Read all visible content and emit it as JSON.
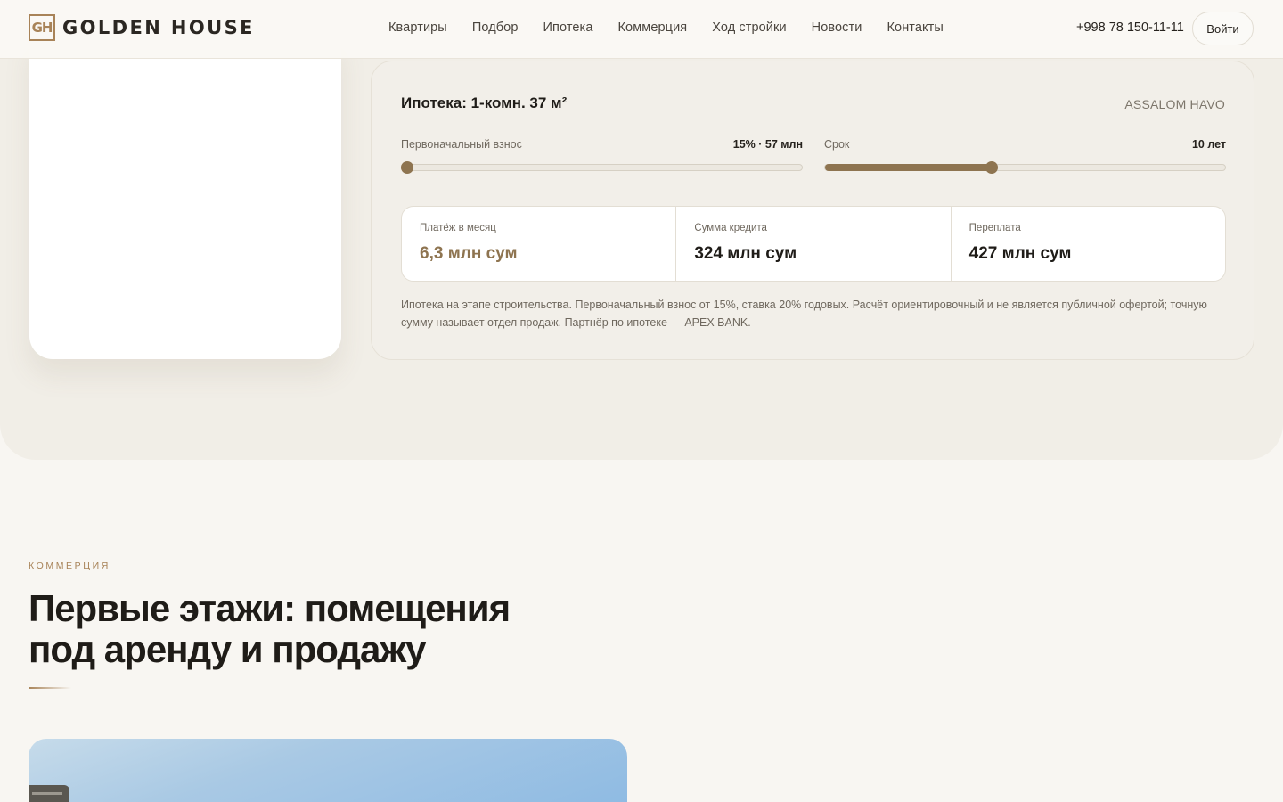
{
  "header": {
    "logo_mark": "GH",
    "logo_text": "GOLDEN HOUSE",
    "nav": [
      {
        "label": "Квартиры"
      },
      {
        "label": "Подбор"
      },
      {
        "label": "Ипотека"
      },
      {
        "label": "Коммерция"
      },
      {
        "label": "Ход стройки"
      },
      {
        "label": "Новости"
      },
      {
        "label": "Контакты"
      }
    ],
    "phone": "+998 78 150-11-11",
    "login_label": "Войти"
  },
  "mortgage": {
    "title": "Ипотека: 1-комн. 37 м²",
    "partner_label": "ASSALOM HAVO",
    "down_payment": {
      "label": "Первоначальный взнос",
      "value_text": "15% · 57 млн",
      "level": 0.0
    },
    "term": {
      "label": "Срок",
      "value_text": "10 лет",
      "level": 0.415
    },
    "stats": [
      {
        "label": "Платёж в месяц",
        "value": "6,3 млн сум"
      },
      {
        "label": "Сумма кредита",
        "value": "324 млн сум"
      },
      {
        "label": "Переплата",
        "value": "427 млн сум"
      }
    ],
    "note": "Ипотека на этапе строительства. Первоначальный взнос от 15%, ставка 20% годовых. Расчёт ориентировочный и не является публичной офертой; точную сумму называет отдел продаж. Партнёр по ипотеке — APEX BANK."
  },
  "commerce": {
    "eyebrow": "КОММЕРЦИЯ",
    "title": "Первые этажи: помещения под аренду и продажу"
  },
  "colors": {
    "accent": "#8e7450",
    "gold": "#a88358",
    "panel_bg": "#f1eee7",
    "page_bg": "#f8f6f2"
  }
}
